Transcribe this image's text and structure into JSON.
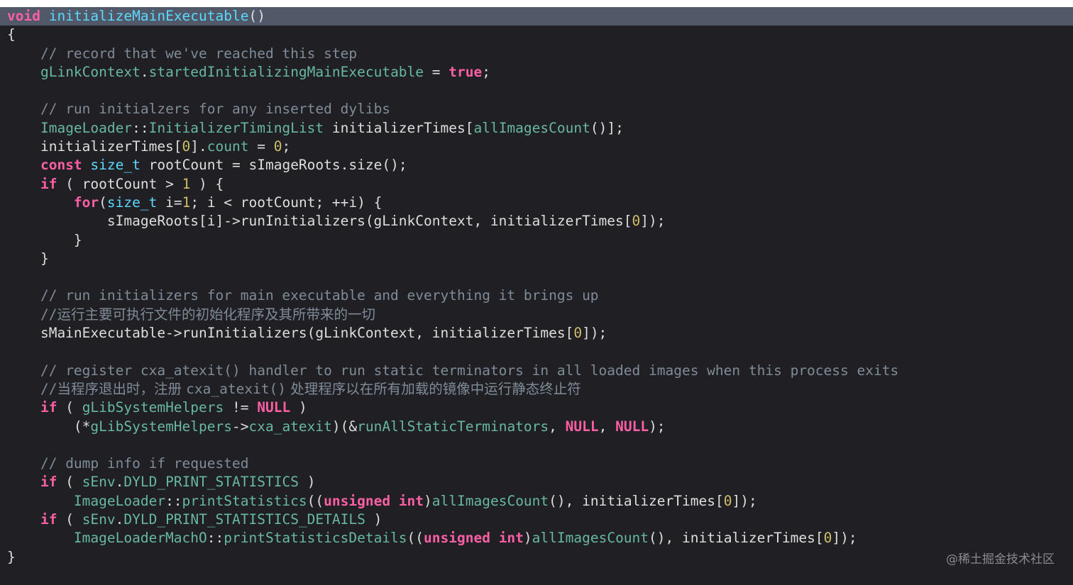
{
  "colors": {
    "background": "#1f1f24",
    "highlight_line": "#515867",
    "keyword": "#fc5fa3",
    "type": "#5dd8ff",
    "function": "#67b7a4",
    "project": "#a167e6",
    "number": "#d0bf69",
    "comment": "#7f8c98",
    "plain": "#dedede"
  },
  "code_lines": [
    [
      [
        "kw",
        "void"
      ],
      [
        "pl",
        " "
      ],
      [
        "ty",
        "initializeMainExecutable"
      ],
      [
        "pl",
        "()"
      ]
    ],
    [
      [
        "pl",
        "{"
      ]
    ],
    [
      [
        "pl",
        "    "
      ],
      [
        "cm",
        "// record that we've reached this step"
      ]
    ],
    [
      [
        "pl",
        "    "
      ],
      [
        "fn",
        "gLinkContext"
      ],
      [
        "pl",
        "."
      ],
      [
        "fn",
        "startedInitializingMainExecutable"
      ],
      [
        "pl",
        " = "
      ],
      [
        "kw",
        "true"
      ],
      [
        "pl",
        ";"
      ]
    ],
    [
      [
        "pl",
        ""
      ]
    ],
    [
      [
        "pl",
        "    "
      ],
      [
        "cm",
        "// run initialzers for any inserted dylibs"
      ]
    ],
    [
      [
        "pl",
        "    "
      ],
      [
        "fn",
        "ImageLoader"
      ],
      [
        "pl",
        "::"
      ],
      [
        "fn",
        "InitializerTimingList"
      ],
      [
        "pl",
        " initializerTimes["
      ],
      [
        "fn",
        "allImagesCount"
      ],
      [
        "pl",
        "()];"
      ]
    ],
    [
      [
        "pl",
        "    initializerTimes["
      ],
      [
        "num",
        "0"
      ],
      [
        "pl",
        "]."
      ],
      [
        "fn",
        "count"
      ],
      [
        "pl",
        " = "
      ],
      [
        "num",
        "0"
      ],
      [
        "pl",
        ";"
      ]
    ],
    [
      [
        "pl",
        "    "
      ],
      [
        "kw",
        "const"
      ],
      [
        "pl",
        " "
      ],
      [
        "ty",
        "size_t"
      ],
      [
        "pl",
        " rootCount = sImageRoots.size();"
      ]
    ],
    [
      [
        "pl",
        "    "
      ],
      [
        "kw",
        "if"
      ],
      [
        "pl",
        " ( rootCount > "
      ],
      [
        "num",
        "1"
      ],
      [
        "pl",
        " ) {"
      ]
    ],
    [
      [
        "pl",
        "        "
      ],
      [
        "kw",
        "for"
      ],
      [
        "pl",
        "("
      ],
      [
        "ty",
        "size_t"
      ],
      [
        "pl",
        " i="
      ],
      [
        "num",
        "1"
      ],
      [
        "pl",
        "; i < rootCount; ++i) {"
      ]
    ],
    [
      [
        "pl",
        "            sImageRoots[i]->runInitializers(gLinkContext, initializerTimes["
      ],
      [
        "num",
        "0"
      ],
      [
        "pl",
        "]);"
      ]
    ],
    [
      [
        "pl",
        "        }"
      ]
    ],
    [
      [
        "pl",
        "    }"
      ]
    ],
    [
      [
        "pl",
        ""
      ]
    ],
    [
      [
        "pl",
        "    "
      ],
      [
        "cm",
        "// run initializers for main executable and everything it brings up"
      ]
    ],
    [
      [
        "pl",
        "    "
      ],
      [
        "cm",
        "//"
      ],
      [
        "cmc",
        "运行主要可执行文件的初始化程序及其所带来的一切"
      ]
    ],
    [
      [
        "pl",
        "    sMainExecutable->runInitializers(gLinkContext, initializerTimes["
      ],
      [
        "num",
        "0"
      ],
      [
        "pl",
        "]);"
      ]
    ],
    [
      [
        "pl",
        ""
      ]
    ],
    [
      [
        "pl",
        "    "
      ],
      [
        "cm",
        "// register cxa_atexit() handler to run static terminators in all loaded images when this process exits"
      ]
    ],
    [
      [
        "pl",
        "    "
      ],
      [
        "cm",
        "//"
      ],
      [
        "cmc",
        "当程序退出时，注册 "
      ],
      [
        "cm",
        "cxa_atexit()"
      ],
      [
        "cmc",
        " 处理程序以在所有加载的镜像中运行静态终止符"
      ]
    ],
    [
      [
        "pl",
        "    "
      ],
      [
        "kw",
        "if"
      ],
      [
        "pl",
        " ( "
      ],
      [
        "fn",
        "gLibSystemHelpers"
      ],
      [
        "pl",
        " != "
      ],
      [
        "kw",
        "NULL"
      ],
      [
        "pl",
        " )"
      ]
    ],
    [
      [
        "pl",
        "        (*"
      ],
      [
        "fn",
        "gLibSystemHelpers"
      ],
      [
        "pl",
        "->"
      ],
      [
        "fn",
        "cxa_atexit"
      ],
      [
        "pl",
        ")(&"
      ],
      [
        "fn",
        "runAllStaticTerminators"
      ],
      [
        "pl",
        ", "
      ],
      [
        "kw",
        "NULL"
      ],
      [
        "pl",
        ", "
      ],
      [
        "kw",
        "NULL"
      ],
      [
        "pl",
        ");"
      ]
    ],
    [
      [
        "pl",
        ""
      ]
    ],
    [
      [
        "pl",
        "    "
      ],
      [
        "cm",
        "// dump info if requested"
      ]
    ],
    [
      [
        "pl",
        "    "
      ],
      [
        "kw",
        "if"
      ],
      [
        "pl",
        " ( "
      ],
      [
        "fn",
        "sEnv"
      ],
      [
        "pl",
        "."
      ],
      [
        "fn",
        "DYLD_PRINT_STATISTICS"
      ],
      [
        "pl",
        " )"
      ]
    ],
    [
      [
        "pl",
        "        "
      ],
      [
        "fn",
        "ImageLoader"
      ],
      [
        "pl",
        "::"
      ],
      [
        "fn",
        "printStatistics"
      ],
      [
        "pl",
        "(("
      ],
      [
        "kw",
        "unsigned"
      ],
      [
        "pl",
        " "
      ],
      [
        "kw",
        "int"
      ],
      [
        "pl",
        ")"
      ],
      [
        "fn",
        "allImagesCount"
      ],
      [
        "pl",
        "(), initializerTimes["
      ],
      [
        "num",
        "0"
      ],
      [
        "pl",
        "]);"
      ]
    ],
    [
      [
        "pl",
        "    "
      ],
      [
        "kw",
        "if"
      ],
      [
        "pl",
        " ( "
      ],
      [
        "fn",
        "sEnv"
      ],
      [
        "pl",
        "."
      ],
      [
        "fn",
        "DYLD_PRINT_STATISTICS_DETAILS"
      ],
      [
        "pl",
        " )"
      ]
    ],
    [
      [
        "pl",
        "        "
      ],
      [
        "fn",
        "ImageLoaderMachO"
      ],
      [
        "pl",
        "::"
      ],
      [
        "fn",
        "printStatisticsDetails"
      ],
      [
        "pl",
        "(("
      ],
      [
        "kw",
        "unsigned"
      ],
      [
        "pl",
        " "
      ],
      [
        "kw",
        "int"
      ],
      [
        "pl",
        ")"
      ],
      [
        "fn",
        "allImagesCount"
      ],
      [
        "pl",
        "(), initializerTimes["
      ],
      [
        "num",
        "0"
      ],
      [
        "pl",
        "]);"
      ]
    ],
    [
      [
        "pl",
        "}"
      ]
    ]
  ],
  "watermark": "@稀土掘金技术社区"
}
